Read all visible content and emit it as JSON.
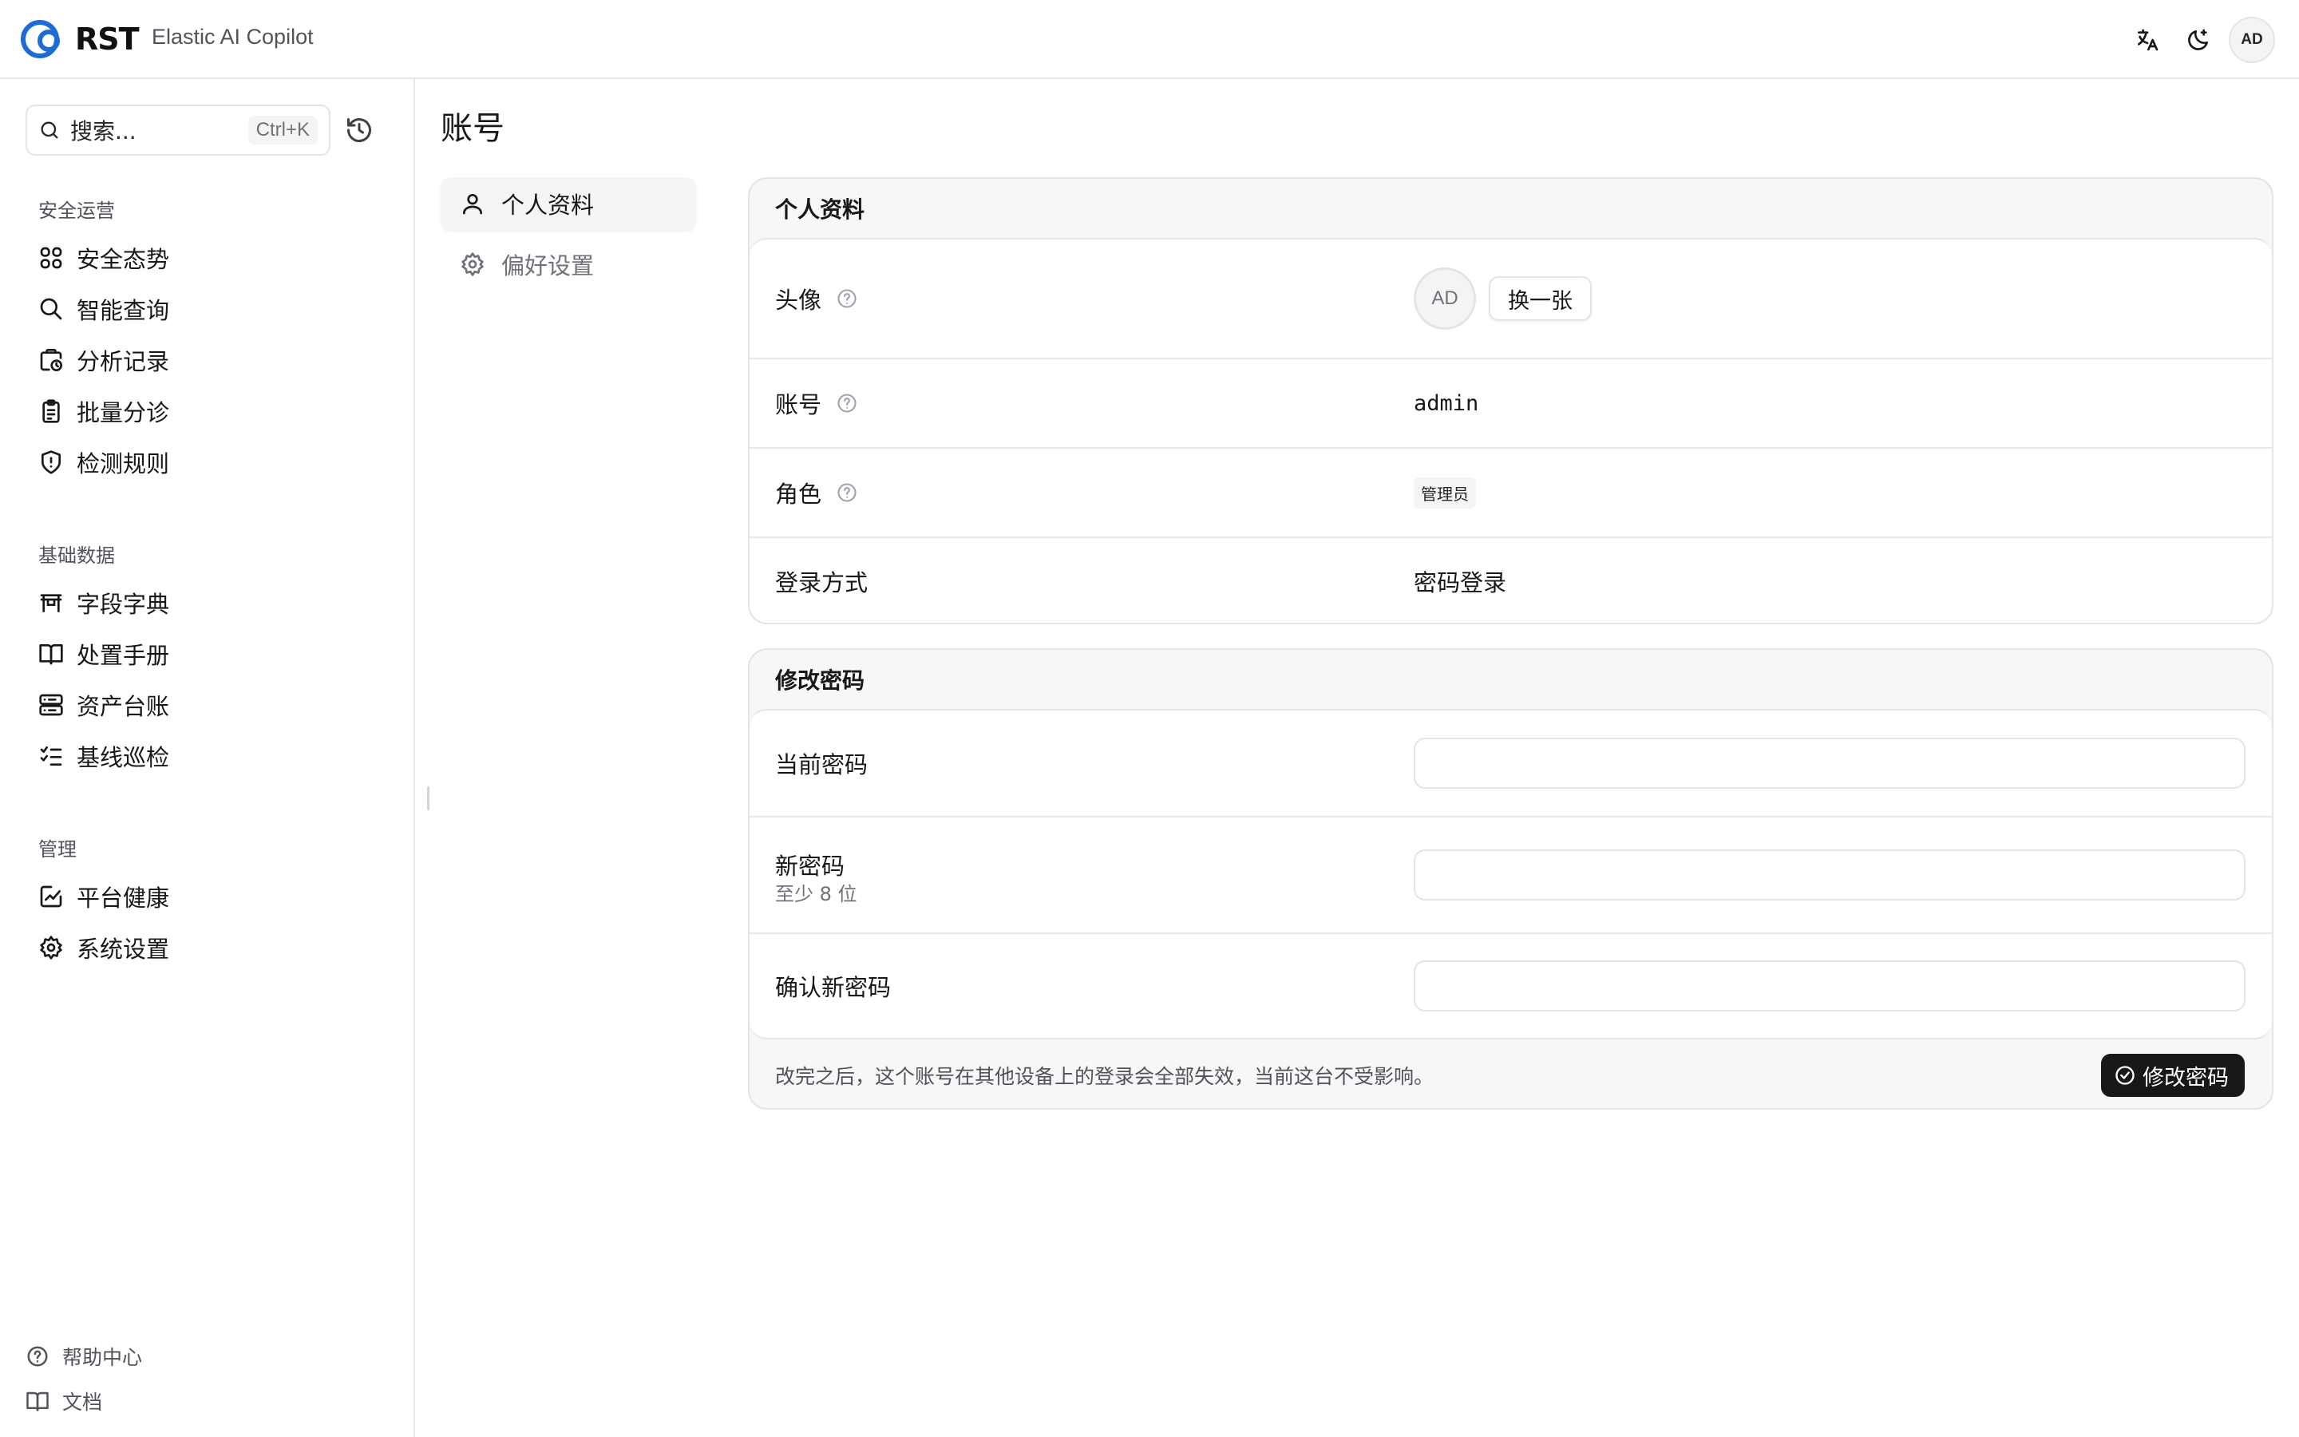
{
  "app": {
    "logo_text": "RST",
    "subtitle": "Elastic AI Copilot",
    "user_initials": "AD"
  },
  "topbar": {
    "icons": [
      "translate-icon",
      "theme-moon-icon"
    ]
  },
  "search": {
    "placeholder": "搜索...",
    "shortcut": "Ctrl+K"
  },
  "sidebar": {
    "groups": [
      {
        "label": "安全运营",
        "items": [
          {
            "label": "安全态势",
            "icon": "dashboard-grid-icon"
          },
          {
            "label": "智能查询",
            "icon": "search-icon"
          },
          {
            "label": "分析记录",
            "icon": "history-record-icon"
          },
          {
            "label": "批量分诊",
            "icon": "clipboard-list-icon"
          },
          {
            "label": "检测规则",
            "icon": "shield-alert-icon"
          }
        ]
      },
      {
        "label": "基础数据",
        "items": [
          {
            "label": "字段字典",
            "icon": "table-icon"
          },
          {
            "label": "处置手册",
            "icon": "book-open-icon"
          },
          {
            "label": "资产台账",
            "icon": "server-icon"
          },
          {
            "label": "基线巡检",
            "icon": "list-checks-icon"
          }
        ]
      },
      {
        "label": "管理",
        "items": [
          {
            "label": "平台健康",
            "icon": "activity-chart-icon"
          },
          {
            "label": "系统设置",
            "icon": "gear-icon"
          }
        ]
      }
    ],
    "footer": [
      {
        "label": "帮助中心",
        "icon": "help-circle-icon"
      },
      {
        "label": "文档",
        "icon": "book-icon"
      }
    ]
  },
  "page": {
    "title": "账号",
    "subnav": [
      {
        "label": "个人资料",
        "icon": "user-icon",
        "active": true
      },
      {
        "label": "偏好设置",
        "icon": "gear-icon",
        "active": false
      }
    ]
  },
  "profile": {
    "title": "个人资料",
    "avatar": {
      "label": "头像",
      "initials": "AD",
      "change_button": "换一张"
    },
    "account": {
      "label": "账号",
      "value": "admin"
    },
    "role": {
      "label": "角色",
      "value": "管理员"
    },
    "login": {
      "label": "登录方式",
      "value": "密码登录"
    }
  },
  "password": {
    "title": "修改密码",
    "current": {
      "label": "当前密码",
      "value": ""
    },
    "new": {
      "label": "新密码",
      "hint": "至少 8 位",
      "value": ""
    },
    "confirm": {
      "label": "确认新密码",
      "value": ""
    },
    "note": "改完之后，这个账号在其他设备上的登录会全部失效，当前这台不受影响。",
    "submit_label": "修改密码"
  }
}
